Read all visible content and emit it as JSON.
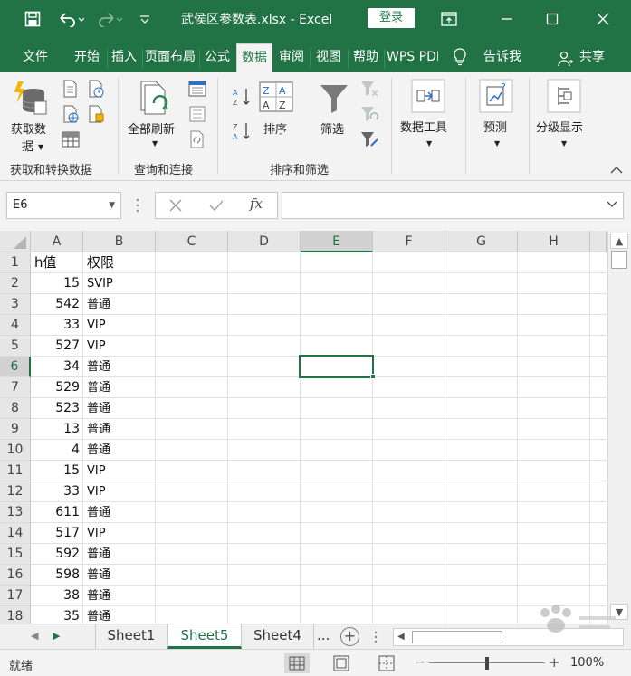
{
  "titlebar": {
    "filename": "武侯区参数表.xlsx  -  Excel",
    "login_label": "登录",
    "colors": {
      "brand": "#217346"
    }
  },
  "ribbon_tabs": [
    {
      "label": "文件"
    },
    {
      "label": "开始"
    },
    {
      "label": "插入"
    },
    {
      "label": "页面布局"
    },
    {
      "label": "公式"
    },
    {
      "label": "数据"
    },
    {
      "label": "审阅"
    },
    {
      "label": "视图"
    },
    {
      "label": "帮助"
    },
    {
      "label": "WPS PDF"
    }
  ],
  "tell_me": "告诉我",
  "share": "共享",
  "ribbon": {
    "get_data": "获取数",
    "get_data_2": "据",
    "refresh_all": "全部刷新",
    "sort": "排序",
    "filter": "筛选",
    "data_tools": "数据工具",
    "forecast": "预测",
    "outline": "分级显示",
    "groups": {
      "get_transform": "获取和转换数据",
      "queries": "查询和连接",
      "sort_filter": "排序和筛选"
    }
  },
  "formula_bar": {
    "name_box": "E6",
    "fx": "fx",
    "formula": ""
  },
  "columns": [
    "A",
    "B",
    "C",
    "D",
    "E",
    "F",
    "G",
    "H"
  ],
  "selected": {
    "column": "E",
    "row": "6"
  },
  "rows": [
    {
      "num": "1",
      "a": "h值",
      "b": "权限"
    },
    {
      "num": "2",
      "a": "15",
      "b": "SVIP"
    },
    {
      "num": "3",
      "a": "542",
      "b": "普通"
    },
    {
      "num": "4",
      "a": "33",
      "b": "VIP"
    },
    {
      "num": "5",
      "a": "527",
      "b": "VIP"
    },
    {
      "num": "6",
      "a": "34",
      "b": "普通"
    },
    {
      "num": "7",
      "a": "529",
      "b": "普通"
    },
    {
      "num": "8",
      "a": "523",
      "b": "普通"
    },
    {
      "num": "9",
      "a": "13",
      "b": "普通"
    },
    {
      "num": "10",
      "a": "4",
      "b": "普通"
    },
    {
      "num": "11",
      "a": "15",
      "b": "VIP"
    },
    {
      "num": "12",
      "a": "33",
      "b": "VIP"
    },
    {
      "num": "13",
      "a": "611",
      "b": "普通"
    },
    {
      "num": "14",
      "a": "517",
      "b": "VIP"
    },
    {
      "num": "15",
      "a": "592",
      "b": "普通"
    },
    {
      "num": "16",
      "a": "598",
      "b": "普通"
    },
    {
      "num": "17",
      "a": "38",
      "b": "普通"
    },
    {
      "num": "18",
      "a": "35",
      "b": "普通"
    }
  ],
  "sheets": [
    {
      "label": "Sheet1"
    },
    {
      "label": "Sheet5"
    },
    {
      "label": "Sheet4"
    }
  ],
  "sheet_more": "...",
  "status": {
    "ready": "就绪",
    "zoom": "100%"
  }
}
